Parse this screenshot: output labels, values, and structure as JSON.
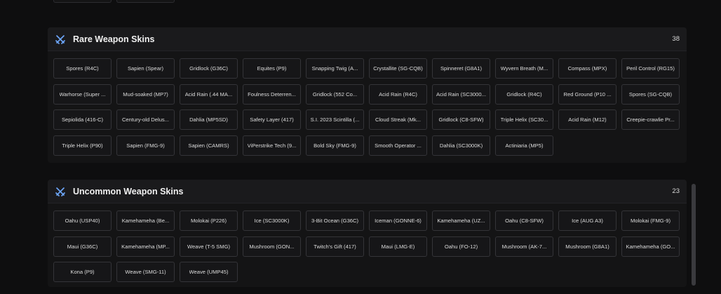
{
  "rare": {
    "title": "Rare Weapon Skins",
    "count": "38",
    "icon": "crossed-swords-icon",
    "items": [
      "Spores (R4C)",
      "Sapien (Spear)",
      "Gridlock (G36C)",
      "Equites (P9)",
      "Snapping Twig (A...",
      "Crystallite (SG-CQB)",
      "Spinneret (G8A1)",
      "Wyvern Breath (M...",
      "Compass (MPX)",
      "Peril Control (RG15)",
      "Warhorse (Super ...",
      "Mud-soaked (MP7)",
      "Acid Rain (.44 MA...",
      "Foulness Deterren...",
      "Gridlock (552 Co...",
      "Acid Rain (R4C)",
      "Acid Rain (SC3000...",
      "Gridlock (R4C)",
      "Red Ground (P10 ...",
      "Spores (SG-CQB)",
      "Sepiolida (416-C)",
      "Century-old Delus...",
      "Dahlia (MP5SD)",
      "Safety Layer (417)",
      "S.I. 2023 Scintilla (...",
      "Cloud Streak (Mk...",
      "Gridlock (C8-SFW)",
      "Triple Helix (SC30...",
      "Acid Rain (M12)",
      "Creepie-crawlie Pr...",
      "Triple Helix (P90)",
      "Sapien (FMG-9)",
      "Sapien (CAMRS)",
      "ViPerstrike Tech (9...",
      "Bold Sky (FMG-9)",
      "Smooth Operator ...",
      "Dahlia (SC3000K)",
      "Actiniaria (MP5)"
    ]
  },
  "uncommon": {
    "title": "Uncommon Weapon Skins",
    "count": "23",
    "icon": "crossed-swords-icon",
    "items": [
      "Oahu (USP40)",
      "Kamehameha (Be...",
      "Molokai (P226)",
      "Ice (SC3000K)",
      "3-Bit Ocean (G36C)",
      "Iceman (GONNE-6)",
      "Kamehameha (UZ...",
      "Oahu (C8-SFW)",
      "Ice (AUG A3)",
      "Molokai (FMG-9)",
      "Maui (G36C)",
      "Kamehameha (MP...",
      "Weave (T-5 SMG)",
      "Mushroom (GON...",
      "Twitch's Gift (417)",
      "Maui (LMG-E)",
      "Oahu (FO-12)",
      "Mushroom (AK-7...",
      "Mushroom (G8A1)",
      "Kamehameha (GO...",
      "Kona (P9)",
      "Weave (SMG-11)",
      "Weave (UMP45)"
    ]
  },
  "colors": {
    "icon": "#6ea8fe",
    "background": "#0e0e0f"
  }
}
